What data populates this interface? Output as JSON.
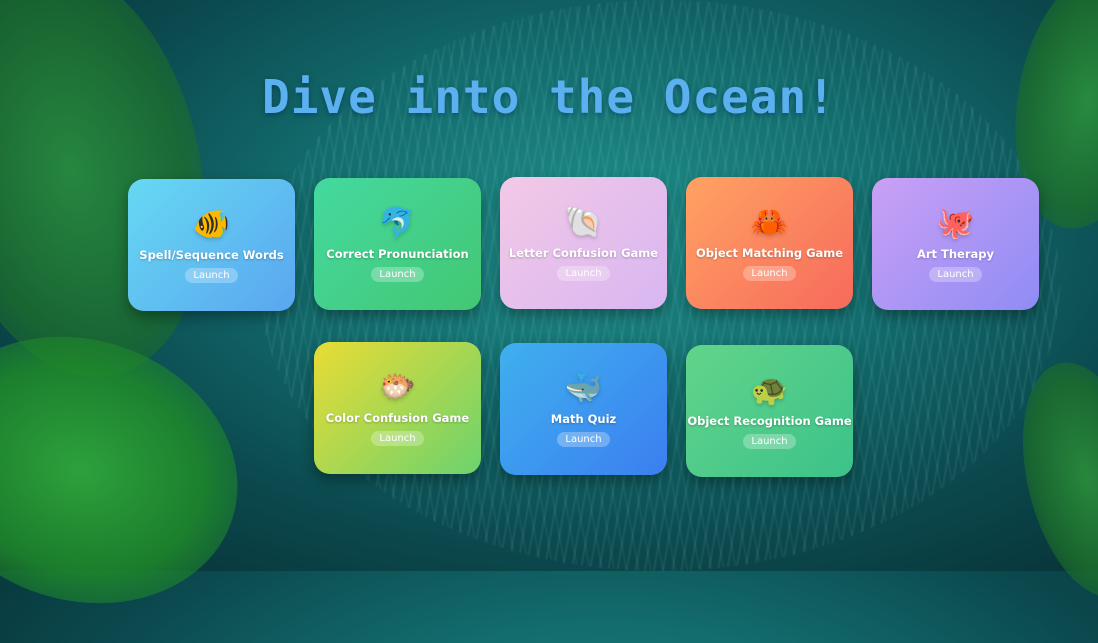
{
  "title": "Dive into the Ocean!",
  "cards": [
    {
      "label": "Spell/Sequence Words",
      "launch": "Launch",
      "icon": "tropical-fish",
      "glyph": "🐠",
      "gradient": [
        "#66d9f2",
        "#5aa6f0"
      ]
    },
    {
      "label": "Correct Pronunciation",
      "launch": "Launch",
      "icon": "dolphin",
      "glyph": "🐬",
      "gradient": [
        "#44d9a0",
        "#43c773"
      ]
    },
    {
      "label": "Letter Confusion Game",
      "launch": "Launch",
      "icon": "spiral-shell",
      "glyph": "🐚",
      "gradient": [
        "#f3c9e6",
        "#d8b6f2"
      ]
    },
    {
      "label": "Object Matching Game",
      "launch": "Launch",
      "icon": "crab",
      "glyph": "🦀",
      "gradient": [
        "#ffa263",
        "#f76a5c"
      ]
    },
    {
      "label": "Art Therapy",
      "launch": "Launch",
      "icon": "octopus",
      "glyph": "🐙",
      "gradient": [
        "#caa0f5",
        "#8f8cf5"
      ]
    },
    {
      "label": "Color Confusion Game",
      "launch": "Launch",
      "icon": "blowfish",
      "glyph": "🐡",
      "gradient": [
        "#e9dc34",
        "#6bd36e"
      ]
    },
    {
      "label": "Math Quiz",
      "launch": "Launch",
      "icon": "whale",
      "glyph": "🐳",
      "gradient": [
        "#3fb0ee",
        "#3b7ff0"
      ]
    },
    {
      "label": "Object Recognition Game",
      "launch": "Launch",
      "icon": "turtle",
      "glyph": "🐢",
      "gradient": [
        "#62d48a",
        "#3cc28a"
      ]
    }
  ]
}
